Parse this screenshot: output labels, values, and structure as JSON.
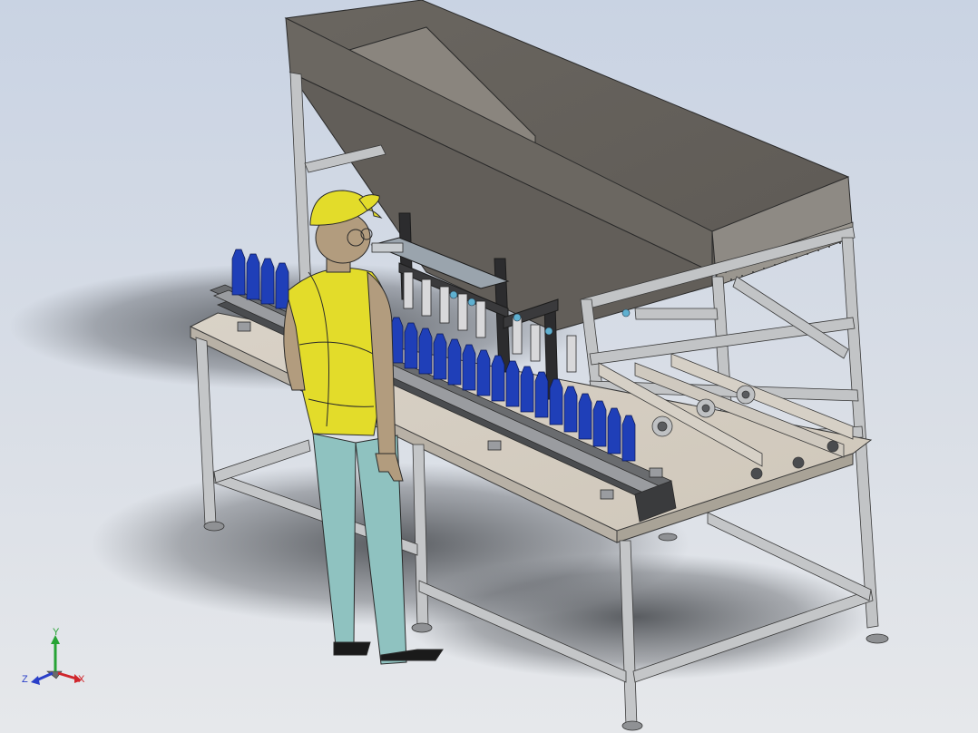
{
  "viewport": {
    "background_top": "#c9d3e3",
    "background_bottom": "#e6e8eb"
  },
  "triad": {
    "x_label": "X",
    "y_label": "Y",
    "z_label": "Z",
    "x_color": "#d0262c",
    "y_color": "#26a334",
    "z_color": "#2a3fc8"
  },
  "model": {
    "hopper_color": "#6f6b66",
    "frame_color": "#b4b6b8",
    "bottle_color": "#1f3fb8",
    "person_shirt_color": "#e3dc2a",
    "person_pants_color": "#8fc2c0",
    "person_skin_color": "#b29c7e"
  }
}
